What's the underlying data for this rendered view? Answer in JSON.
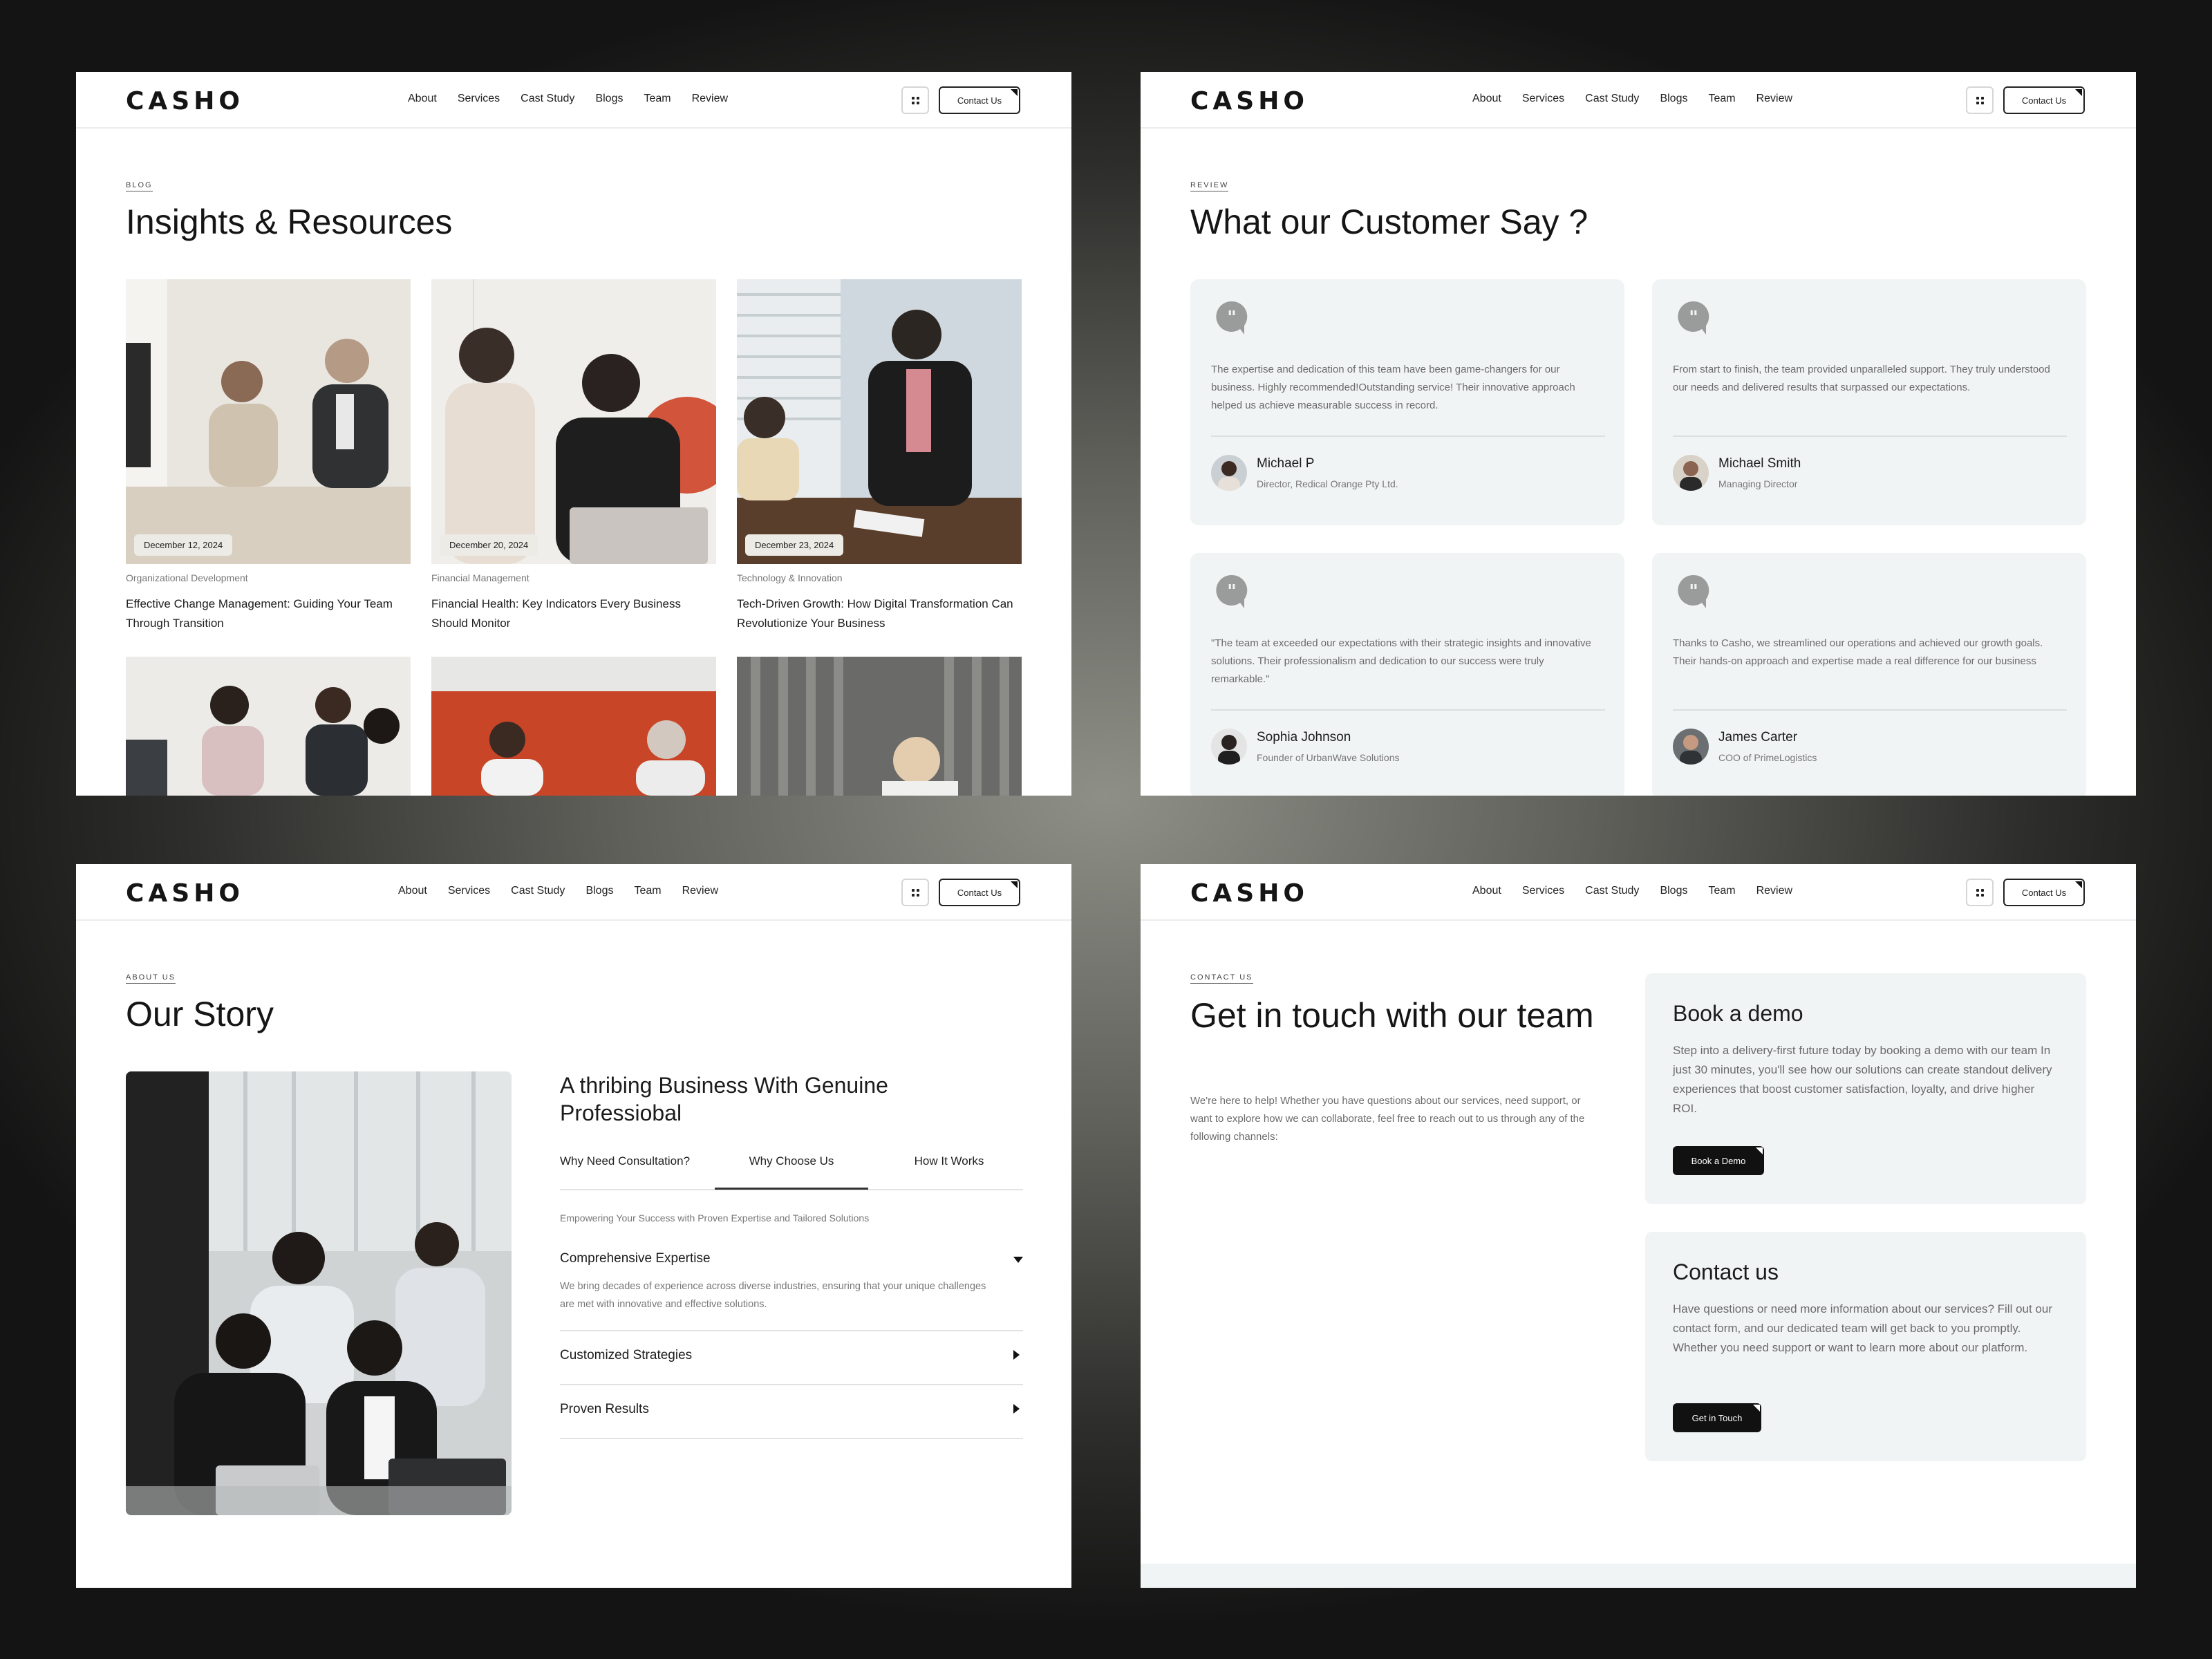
{
  "brand": "CASHO",
  "nav": {
    "items": [
      "About",
      "Services",
      "Cast Study",
      "Blogs",
      "Team",
      "Review"
    ],
    "contact_label": "Contact Us",
    "grid_icon": "grid-icon"
  },
  "blog": {
    "eyebrow": "BLOG",
    "title": "Insights & Resources",
    "posts": [
      {
        "date": "December 12, 2024",
        "category": "Organizational Development",
        "title": "Effective Change Management: Guiding Your Team Through Transition"
      },
      {
        "date": "December 20, 2024",
        "category": "Financial Management",
        "title": "Financial Health: Key Indicators Every Business Should Monitor"
      },
      {
        "date": "December 23, 2024",
        "category": "Technology & Innovation",
        "title": "Tech-Driven Growth: How Digital Transformation Can Revolutionize Your Business"
      }
    ]
  },
  "review": {
    "eyebrow": "REVIEW",
    "title": "What our Customer Say ?",
    "quote_icon": "quote-icon",
    "items": [
      {
        "text": "The expertise and dedication of this team have been game-changers for our business. Highly recommended!Outstanding service! Their innovative approach helped us achieve measurable success in record.",
        "name": "Michael P",
        "role": "Director, Redical Orange Pty Ltd."
      },
      {
        "text": "From start to finish, the team provided unparalleled support. They truly understood our needs and delivered results that surpassed our expectations.",
        "name": "Michael Smith",
        "role": "Managing Director"
      },
      {
        "text": "\"The team at exceeded our expectations with their strategic insights and innovative solutions. Their professionalism and dedication to our success were truly remarkable.\"",
        "name": "Sophia Johnson",
        "role": "Founder of UrbanWave Solutions"
      },
      {
        "text": "Thanks to Casho, we streamlined our operations and achieved our growth goals. Their hands-on approach and expertise made a real difference for our business",
        "name": "James Carter",
        "role": "COO of PrimeLogistics"
      }
    ]
  },
  "about": {
    "eyebrow": "ABOUT US",
    "title": "Our Story",
    "heading": "A thribing Business With Genuine Professiobal",
    "tabs": [
      "Why Need Consultation?",
      "Why Choose Us",
      "How It Works"
    ],
    "active_tab": "Why Choose Us",
    "subtitle": "Empowering Your Success with Proven Expertise and Tailored Solutions",
    "accordion": [
      {
        "title": "Comprehensive Expertise",
        "body": "We bring decades of experience across diverse industries, ensuring that your unique challenges are met with innovative and effective solutions.",
        "open": true
      },
      {
        "title": "Customized Strategies",
        "open": false
      },
      {
        "title": "Proven Results",
        "open": false
      }
    ]
  },
  "contact": {
    "eyebrow": "CONTACT US",
    "title": "Get in touch with our team",
    "body": "We're here to help! Whether you have questions about our services, need support, or want to explore how we can collaborate, feel free to reach out to us through any of the following channels:",
    "demo": {
      "title": "Book a demo",
      "body": "Step into a delivery-first future today by booking a demo with our team In just 30 minutes, you'll see how our solutions can create standout delivery experiences that boost customer satisfaction, loyalty, and drive higher ROI.",
      "button": "Book a Demo"
    },
    "contact_box": {
      "title": "Contact us",
      "body": "Have questions or need more information about our services? Fill out our contact form, and our dedicated team will get back to you promptly. Whether you need support or want to learn more about our platform.",
      "button": "Get in Touch"
    }
  },
  "colors": {
    "card_bg": "#f1f4f4",
    "dark": "#111111",
    "muted": "#777777"
  }
}
